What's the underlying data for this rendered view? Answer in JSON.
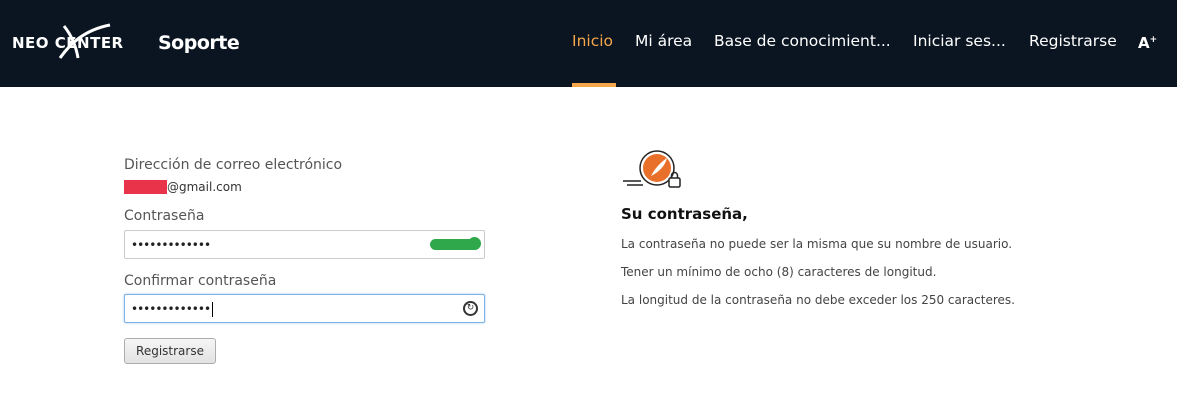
{
  "header": {
    "logo_text": "NEO CENTER",
    "logo_subtitle": "Soporte",
    "nav": [
      {
        "label": "Inicio",
        "active": true
      },
      {
        "label": "Mi área"
      },
      {
        "label": "Base de conocimient..."
      },
      {
        "label": "Iniciar ses..."
      },
      {
        "label": "Registrarse"
      }
    ],
    "font_toggle": "A+",
    "colors": {
      "background": "#0b1521",
      "accent": "#f5a54a"
    }
  },
  "form": {
    "email_label": "Dirección de correo electrónico",
    "email_value_suffix": "@gmail.com",
    "password_label": "Contraseña",
    "password_value": "•••••••••••••",
    "password_strength": "strong",
    "confirm_label": "Confirmar contraseña",
    "confirm_value": "•••••••••••••",
    "submit_label": "Registrarse"
  },
  "info": {
    "title": "Su contraseña,",
    "rules": [
      "La contraseña no puede ser la misma que su nombre de usuario.",
      "Tener un mínimo de ocho (8) caracteres de longitud.",
      "La longitud de la contraseña no debe exceder los 250 caracteres."
    ],
    "icon": "password-lock-icon",
    "icon_color": "#e8702a"
  }
}
